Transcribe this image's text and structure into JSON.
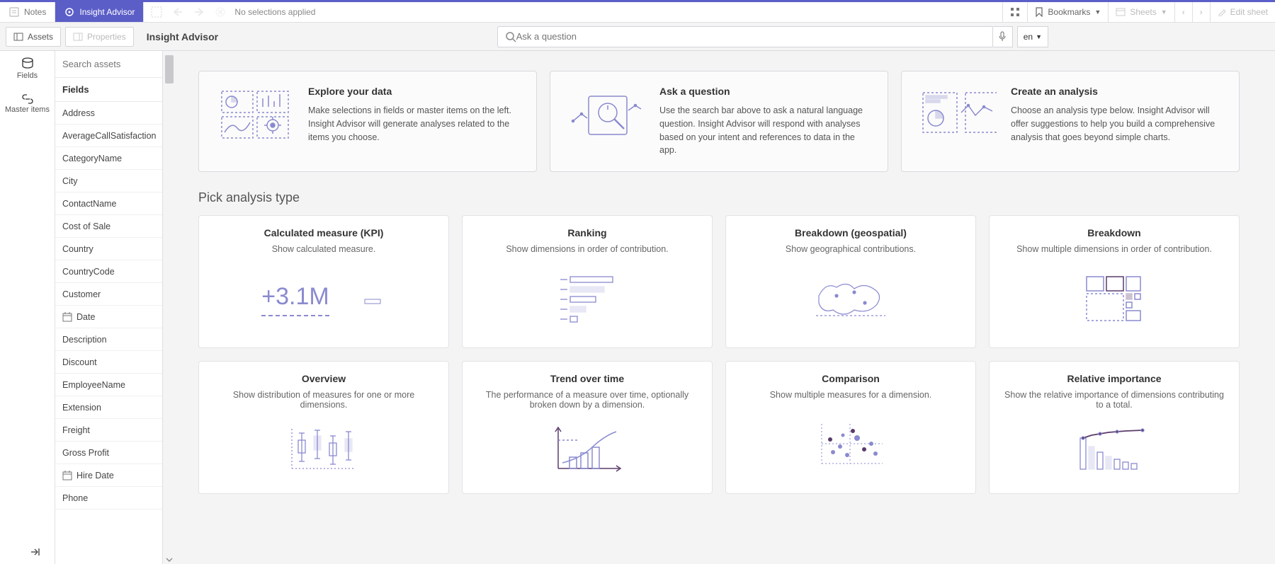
{
  "topbar": {
    "notes": "Notes",
    "insight": "Insight Advisor",
    "no_selections": "No selections applied",
    "bookmarks": "Bookmarks",
    "sheets": "Sheets",
    "edit": "Edit sheet"
  },
  "secondbar": {
    "assets": "Assets",
    "properties": "Properties",
    "title": "Insight Advisor",
    "search_placeholder": "Ask a question",
    "lang": "en"
  },
  "vrail": {
    "fields": "Fields",
    "master": "Master items"
  },
  "panel": {
    "search_placeholder": "Search assets",
    "header": "Fields",
    "fields": [
      {
        "icon": "",
        "label": "Address"
      },
      {
        "icon": "",
        "label": "AverageCallSatisfaction"
      },
      {
        "icon": "",
        "label": "CategoryName"
      },
      {
        "icon": "",
        "label": "City"
      },
      {
        "icon": "",
        "label": "ContactName"
      },
      {
        "icon": "",
        "label": "Cost of Sale"
      },
      {
        "icon": "",
        "label": "Country"
      },
      {
        "icon": "",
        "label": "CountryCode"
      },
      {
        "icon": "",
        "label": "Customer"
      },
      {
        "icon": "cal",
        "label": "Date"
      },
      {
        "icon": "",
        "label": "Description"
      },
      {
        "icon": "",
        "label": "Discount"
      },
      {
        "icon": "",
        "label": "EmployeeName"
      },
      {
        "icon": "",
        "label": "Extension"
      },
      {
        "icon": "",
        "label": "Freight"
      },
      {
        "icon": "",
        "label": "Gross Profit"
      },
      {
        "icon": "cal",
        "label": "Hire Date"
      },
      {
        "icon": "",
        "label": "Phone"
      }
    ]
  },
  "intro": [
    {
      "title": "Explore your data",
      "desc": "Make selections in fields or master items on the left. Insight Advisor will generate analyses related to the items you choose."
    },
    {
      "title": "Ask a question",
      "desc": "Use the search bar above to ask a natural language question. Insight Advisor will respond with analyses based on your intent and references to data in the app."
    },
    {
      "title": "Create an analysis",
      "desc": "Choose an analysis type below. Insight Advisor will offer suggestions to help you build a comprehensive analysis that goes beyond simple charts."
    }
  ],
  "section_title": "Pick analysis type",
  "types": [
    {
      "title": "Calculated measure (KPI)",
      "desc": "Show calculated measure.",
      "img": "kpi"
    },
    {
      "title": "Ranking",
      "desc": "Show dimensions in order of contribution.",
      "img": "rank"
    },
    {
      "title": "Breakdown (geospatial)",
      "desc": "Show geographical contributions.",
      "img": "geo"
    },
    {
      "title": "Breakdown",
      "desc": "Show multiple dimensions in order of contribution.",
      "img": "tree"
    },
    {
      "title": "Overview",
      "desc": "Show distribution of measures for one or more dimensions.",
      "img": "box"
    },
    {
      "title": "Trend over time",
      "desc": "The performance of a measure over time, optionally broken down by a dimension.",
      "img": "trend"
    },
    {
      "title": "Comparison",
      "desc": "Show multiple measures for a dimension.",
      "img": "compare"
    },
    {
      "title": "Relative importance",
      "desc": "Show the relative importance of dimensions contributing to a total.",
      "img": "pareto"
    }
  ],
  "kpi_value": "+3.1M"
}
